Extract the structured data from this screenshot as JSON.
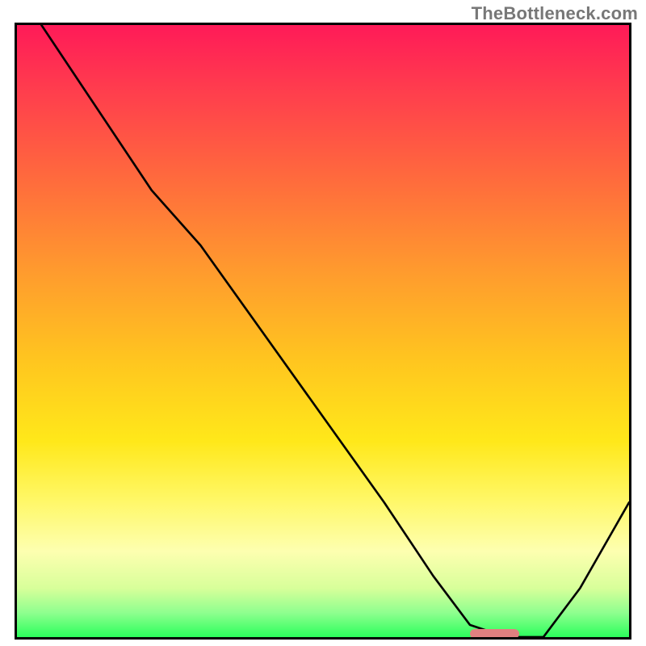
{
  "watermark": "TheBottleneck.com",
  "chart_data": {
    "type": "line",
    "title": "",
    "xlabel": "",
    "ylabel": "",
    "xlim": [
      0,
      100
    ],
    "ylim": [
      0,
      100
    ],
    "grid": false,
    "legend": false,
    "annotations": [],
    "series": [
      {
        "name": "curve",
        "x": [
          4,
          12,
          22,
          30,
          40,
          50,
          60,
          68,
          74,
          80,
          86,
          92,
          100
        ],
        "y": [
          100,
          88,
          73,
          64,
          50,
          36,
          22,
          10,
          2,
          0,
          0,
          8,
          22
        ]
      }
    ],
    "marker": {
      "x_start": 74,
      "x_end": 82,
      "y": 0
    },
    "background_gradient_stops": [
      {
        "pos": 0,
        "color": "#ff1a58"
      },
      {
        "pos": 10,
        "color": "#ff3b4e"
      },
      {
        "pos": 25,
        "color": "#ff6a3d"
      },
      {
        "pos": 40,
        "color": "#ff9a2e"
      },
      {
        "pos": 55,
        "color": "#ffc61f"
      },
      {
        "pos": 68,
        "color": "#ffe81a"
      },
      {
        "pos": 78,
        "color": "#fff86a"
      },
      {
        "pos": 86,
        "color": "#fdffb0"
      },
      {
        "pos": 92,
        "color": "#d8ff9a"
      },
      {
        "pos": 96,
        "color": "#8fff8f"
      },
      {
        "pos": 100,
        "color": "#2bff5c"
      }
    ]
  }
}
